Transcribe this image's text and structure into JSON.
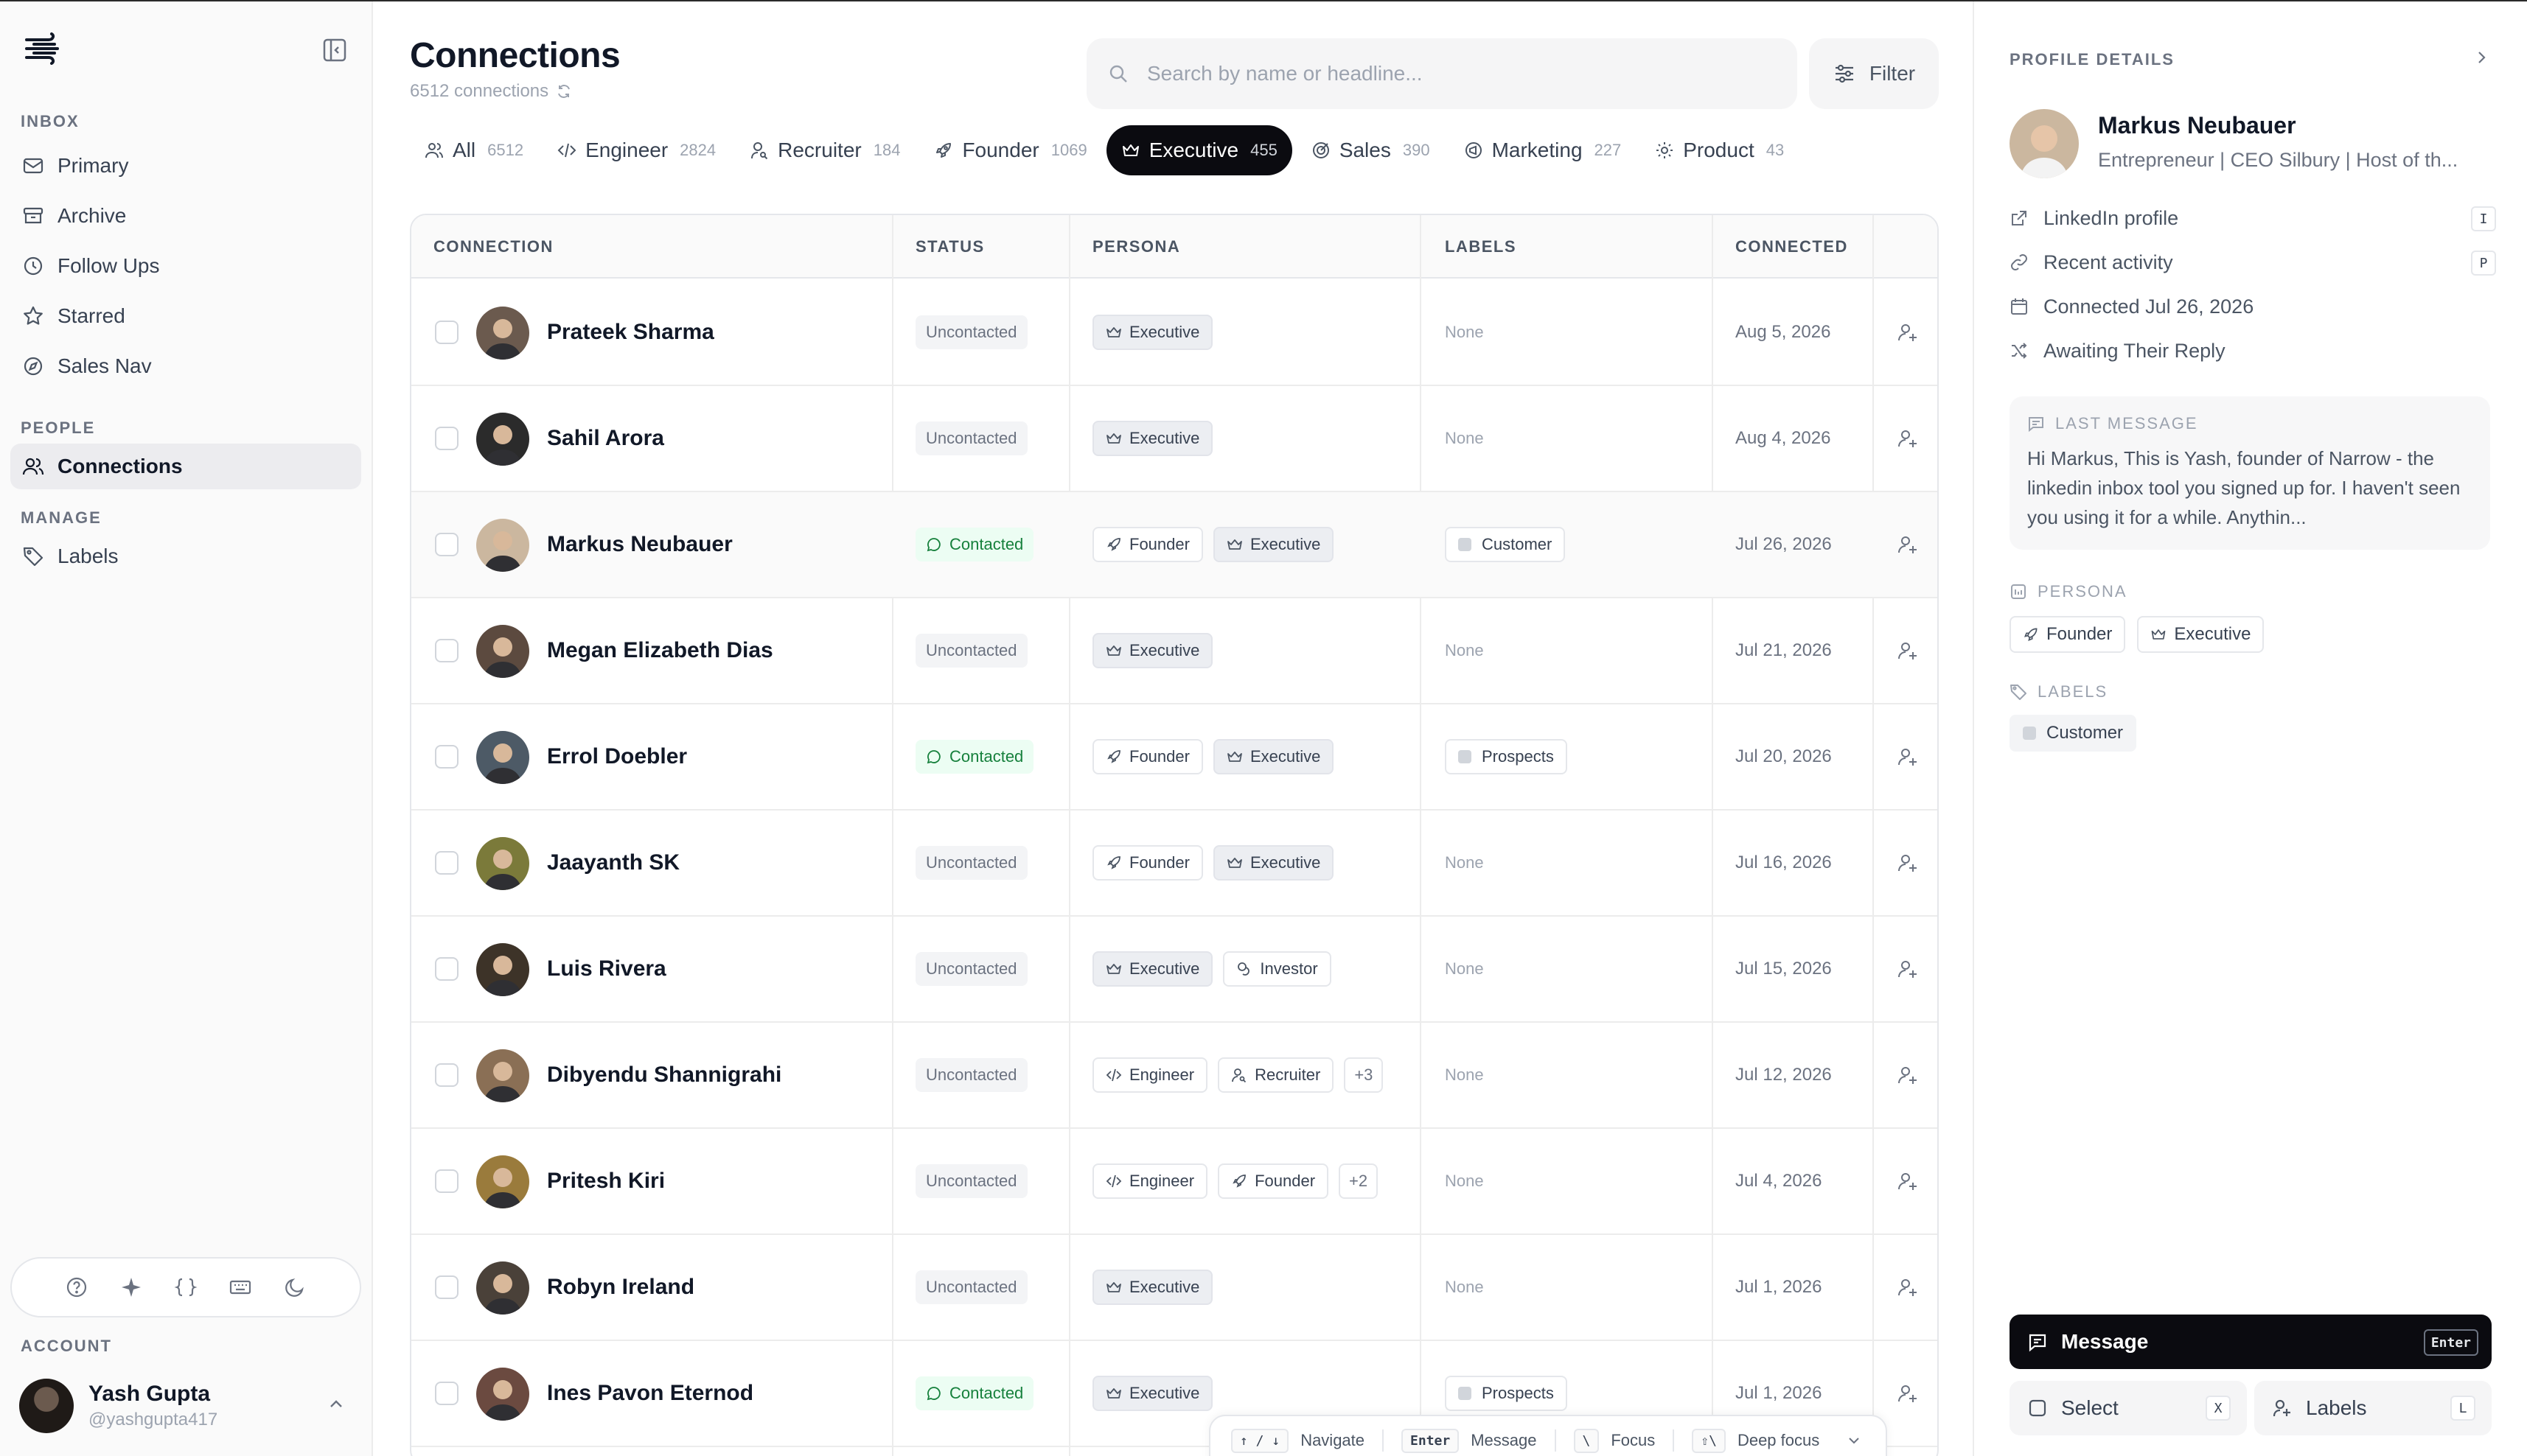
{
  "sidebar": {
    "inbox_label": "INBOX",
    "inbox_items": [
      "Primary",
      "Archive",
      "Follow Ups",
      "Starred",
      "Sales Nav"
    ],
    "people_label": "PEOPLE",
    "people_items": [
      "Connections"
    ],
    "manage_label": "MANAGE",
    "manage_items": [
      "Labels"
    ],
    "account_label": "ACCOUNT",
    "account": {
      "name": "Yash Gupta",
      "handle": "@yashgupta417"
    }
  },
  "header": {
    "title": "Connections",
    "subtitle": "6512 connections",
    "search_placeholder": "Search by name or headline...",
    "filter_label": "Filter"
  },
  "tabs": [
    {
      "label": "All",
      "count": "6512",
      "icon": "users-icon"
    },
    {
      "label": "Engineer",
      "count": "2824",
      "icon": "code-icon"
    },
    {
      "label": "Recruiter",
      "count": "184",
      "icon": "user-search-icon"
    },
    {
      "label": "Founder",
      "count": "1069",
      "icon": "rocket-icon"
    },
    {
      "label": "Executive",
      "count": "455",
      "icon": "crown-icon",
      "active": true
    },
    {
      "label": "Sales",
      "count": "390",
      "icon": "target-icon"
    },
    {
      "label": "Marketing",
      "count": "227",
      "icon": "megaphone-icon"
    },
    {
      "label": "Product",
      "count": "43",
      "icon": "bulb-icon"
    }
  ],
  "table": {
    "columns": [
      "CONNECTION",
      "STATUS",
      "PERSONA",
      "LABELS",
      "CONNECTED"
    ],
    "none_text": "None",
    "rows": [
      {
        "name": "Prateek Sharma",
        "status": "Uncontacted",
        "persona": [
          "Executive"
        ],
        "labels": [],
        "connected": "Aug 5, 2026"
      },
      {
        "name": "Sahil Arora",
        "status": "Uncontacted",
        "persona": [
          "Executive"
        ],
        "labels": [],
        "connected": "Aug 4, 2026"
      },
      {
        "name": "Markus Neubauer",
        "status": "Contacted",
        "persona": [
          "Founder",
          "Executive"
        ],
        "labels": [
          "Customer"
        ],
        "connected": "Jul 26, 2026",
        "selected": true
      },
      {
        "name": "Megan Elizabeth Dias",
        "status": "Uncontacted",
        "persona": [
          "Executive"
        ],
        "labels": [],
        "connected": "Jul 21, 2026"
      },
      {
        "name": "Errol Doebler",
        "status": "Contacted",
        "persona": [
          "Founder",
          "Executive"
        ],
        "labels": [
          "Prospects"
        ],
        "connected": "Jul 20, 2026"
      },
      {
        "name": "Jaayanth SK",
        "status": "Uncontacted",
        "persona": [
          "Founder",
          "Executive"
        ],
        "labels": [],
        "connected": "Jul 16, 2026"
      },
      {
        "name": "Luis Rivera",
        "status": "Uncontacted",
        "persona": [
          "Executive",
          "Investor"
        ],
        "labels": [],
        "connected": "Jul 15, 2026"
      },
      {
        "name": "Dibyendu Shannigrahi",
        "status": "Uncontacted",
        "persona": [
          "Engineer",
          "Recruiter"
        ],
        "more": "+3",
        "labels": [],
        "connected": "Jul 12, 2026"
      },
      {
        "name": "Pritesh Kiri",
        "status": "Uncontacted",
        "persona": [
          "Engineer",
          "Founder"
        ],
        "more": "+2",
        "labels": [],
        "connected": "Jul 4, 2026"
      },
      {
        "name": "Robyn Ireland",
        "status": "Uncontacted",
        "persona": [
          "Executive"
        ],
        "labels": [],
        "connected": "Jul 1, 2026"
      },
      {
        "name": "Ines Pavon Eternod",
        "status": "Contacted",
        "persona": [
          "Executive"
        ],
        "labels": [
          "Prospects"
        ],
        "connected": "Jul 1, 2026"
      }
    ]
  },
  "shortcuts": {
    "nav_keys": "↑ / ↓",
    "nav_label": "Navigate",
    "msg_key": "Enter",
    "msg_label": "Message",
    "focus_key": "\\",
    "focus_label": "Focus",
    "deep_key": "⇧\\",
    "deep_label": "Deep focus"
  },
  "panel": {
    "title": "PROFILE DETAILS",
    "name": "Markus Neubauer",
    "headline": "Entrepreneur | CEO Silbury | Host of th...",
    "linkedin_label": "LinkedIn profile",
    "linkedin_key": "I",
    "activity_label": "Recent activity",
    "activity_key": "P",
    "connected_label": "Connected Jul 26, 2026",
    "awaiting_label": "Awaiting Their Reply",
    "last_message_label": "LAST MESSAGE",
    "last_message": "Hi Markus, This is Yash, founder of Narrow - the linkedin inbox tool you signed up for. I haven't seen you using it for a while. Anythin...",
    "persona_label": "PERSONA",
    "persona": [
      "Founder",
      "Executive"
    ],
    "labels_label": "LABELS",
    "labels": [
      "Customer"
    ],
    "message_btn": "Message",
    "message_key": "Enter",
    "select_btn": "Select",
    "select_key": "X",
    "labels_btn": "Labels",
    "labels_key": "L"
  },
  "colors": {
    "accent_dark": "#0b0b10",
    "contacted_green": "#16803c",
    "muted": "#9ca3af"
  }
}
